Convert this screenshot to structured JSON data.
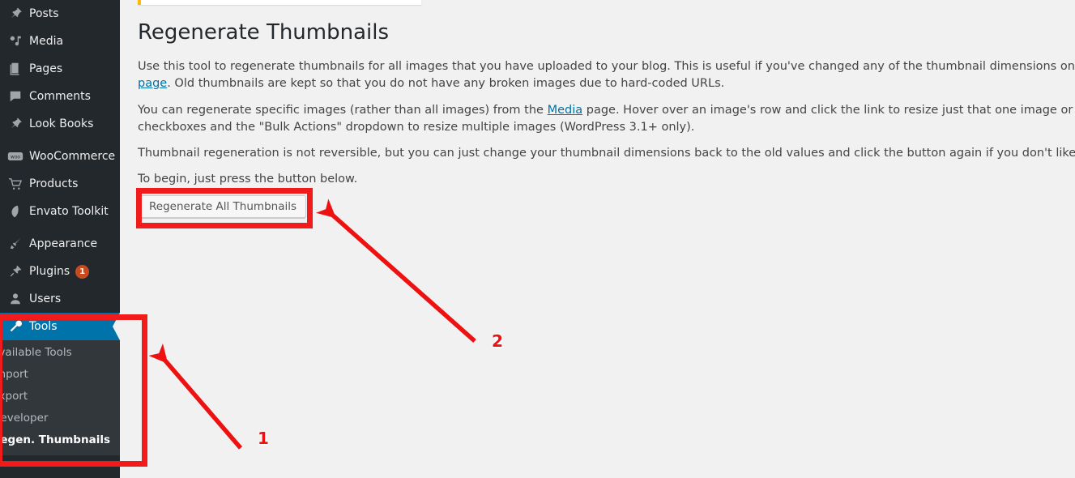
{
  "sidebar": {
    "items": [
      {
        "label": "Posts",
        "icon": "pushpin-icon",
        "badge": null
      },
      {
        "label": "Media",
        "icon": "media-icon",
        "badge": null
      },
      {
        "label": "Pages",
        "icon": "pages-icon",
        "badge": null
      },
      {
        "label": "Comments",
        "icon": "comment-icon",
        "badge": null
      },
      {
        "label": "Look Books",
        "icon": "pushpin-icon",
        "badge": null
      },
      {
        "label": "WooCommerce",
        "icon": "woo-icon",
        "badge": null
      },
      {
        "label": "Products",
        "icon": "cart-icon",
        "badge": null
      },
      {
        "label": "Envato Toolkit",
        "icon": "envato-leaf-icon",
        "badge": null
      },
      {
        "label": "Appearance",
        "icon": "paintbrush-icon",
        "badge": null
      },
      {
        "label": "Plugins",
        "icon": "plug-icon",
        "badge": "1"
      },
      {
        "label": "Users",
        "icon": "user-icon",
        "badge": null
      },
      {
        "label": "Tools",
        "icon": "tools-icon",
        "badge": null
      }
    ],
    "current_item": "Tools",
    "submenu": [
      {
        "label": "Available Tools",
        "current": false
      },
      {
        "label": "Import",
        "current": false
      },
      {
        "label": "Export",
        "current": false
      },
      {
        "label": "Developer",
        "current": false
      },
      {
        "label": "Regen. Thumbnails",
        "current": true
      }
    ]
  },
  "main": {
    "page_title": "Regenerate Thumbnails",
    "paragraph_1": {
      "before_link": "Use this tool to regenerate thumbnails for all images that you have uploaded to your blog. This is useful if you've changed any of the thumbnail dimensions on the ",
      "link": "media settings page",
      "after_link": ". Old thumbnails are kept so that you do not have any broken images due to hard-coded URLs."
    },
    "paragraph_2": {
      "before_link": "You can regenerate specific images (rather than all images) from the ",
      "link": "Media",
      "after_link": " page. Hover over an image's row and click the link to resize just that one image or use the checkboxes and the \"Bulk Actions\" dropdown to resize multiple images (WordPress 3.1+ only)."
    },
    "paragraph_3": "Thumbnail regeneration is not reversible, but you can just change your thumbnail dimensions back to the old values and click the button again if you don't like the results.",
    "paragraph_4": "To begin, just press the button below.",
    "regenerate_button_label": "Regenerate All Thumbnails"
  },
  "annotations": {
    "marker_1": "1",
    "marker_2": "2",
    "color": "#ee1111"
  },
  "colors": {
    "sidebar_bg": "#23282d",
    "submenu_bg": "#32373c",
    "current_highlight": "#0073aa",
    "link": "#0073aa",
    "badge": "#ca4a1f",
    "content_bg": "#f1f1f1",
    "notice_accent": "#ffb900"
  }
}
